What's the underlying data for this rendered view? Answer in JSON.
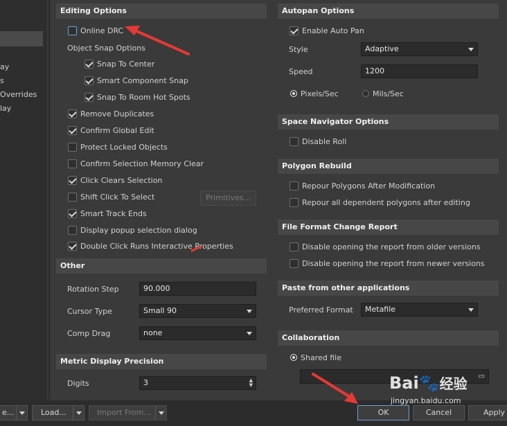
{
  "left_nav": {
    "items": [
      "ay",
      "s",
      "Overrides",
      "lay"
    ]
  },
  "editing_options": {
    "title": "Editing Options",
    "online_drc": "Online DRC",
    "object_snap_options": "Object Snap Options",
    "snap_to_center": "Snap To Center",
    "smart_component_snap": "Smart Component Snap",
    "snap_to_room_hot_spots": "Snap To Room Hot Spots",
    "remove_duplicates": "Remove Duplicates",
    "confirm_global_edit": "Confirm Global Edit",
    "protect_locked_objects": "Protect Locked Objects",
    "confirm_selection_memory_clear": "Confirm Selection Memory Clear",
    "click_clears_selection": "Click Clears Selection",
    "shift_click_to_select": "Shift Click To Select",
    "primitives_button": "Primitives...",
    "smart_track_ends": "Smart Track Ends",
    "display_popup_selection_dialog": "Display popup selection dialog",
    "double_click_runs_interactive_properties": "Double Click Runs Interactive Properties"
  },
  "other": {
    "title": "Other",
    "rotation_step_label": "Rotation Step",
    "rotation_step_value": "90.000",
    "cursor_type_label": "Cursor Type",
    "cursor_type_value": "Small 90",
    "comp_drag_label": "Comp Drag",
    "comp_drag_value": "none"
  },
  "metric_display_precision": {
    "title": "Metric Display Precision",
    "digits_label": "Digits",
    "digits_value": "3"
  },
  "autopan_options": {
    "title": "Autopan Options",
    "enable_auto_pan": "Enable Auto Pan",
    "style_label": "Style",
    "style_value": "Adaptive",
    "speed_label": "Speed",
    "speed_value": "1200",
    "pixels_per_sec": "Pixels/Sec",
    "mils_per_sec": "Mils/Sec"
  },
  "space_navigator_options": {
    "title": "Space Navigator Options",
    "disable_roll": "Disable Roll"
  },
  "polygon_rebuild": {
    "title": "Polygon Rebuild",
    "repour_after_modification": "Repour Polygons After Modification",
    "repour_all_dependent": "Repour all dependent polygons after editing"
  },
  "file_format_change_report": {
    "title": "File Format Change Report",
    "disable_older": "Disable opening the report from older versions",
    "disable_newer": "Disable opening the report from newer versions"
  },
  "paste_from_other_applications": {
    "title": "Paste from other applications",
    "preferred_format_label": "Preferred Format",
    "preferred_format_value": "Metafile"
  },
  "collaboration": {
    "title": "Collaboration",
    "shared_file": "Shared file"
  },
  "footer": {
    "save_partial": "e...",
    "load": "Load...",
    "import_from": "Import From...",
    "ok": "OK",
    "cancel": "Cancel",
    "apply": "Apply"
  },
  "watermark": {
    "brand": "Bai",
    "brand2": "经验",
    "url": "jingyan.baidu.com"
  },
  "colors": {
    "panel_bg": "#3a3a3a",
    "header_bg": "#474747",
    "annotation_arrow": "#e53935"
  }
}
